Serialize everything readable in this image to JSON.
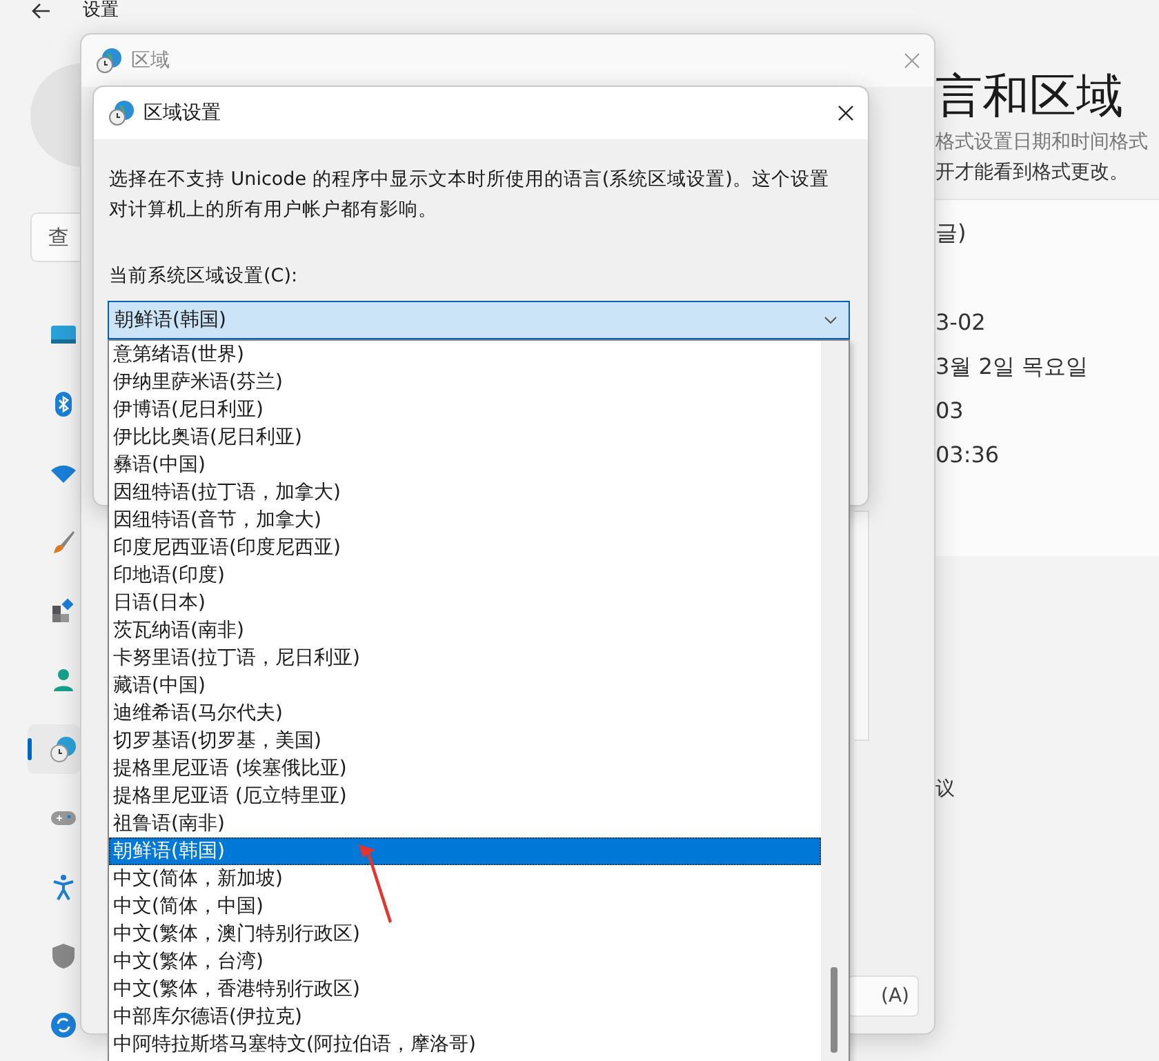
{
  "settings": {
    "title": "设置",
    "search": {
      "placeholder": "查"
    },
    "heading": "言和区域",
    "description": [
      "格式设置日期和时间格式",
      "开才能看到格式更改。"
    ],
    "values": [
      "글)",
      "3-02",
      "3월 2일 목요일",
      "03",
      "03:36"
    ],
    "lower_text": "议",
    "sidebar": {
      "items": [
        {
          "kind": "display",
          "selected": false
        },
        {
          "kind": "bluetooth",
          "selected": false
        },
        {
          "kind": "wifi",
          "selected": false
        },
        {
          "kind": "brush",
          "selected": false
        },
        {
          "kind": "apps",
          "selected": false
        },
        {
          "kind": "person",
          "selected": false
        },
        {
          "kind": "clock",
          "selected": true
        },
        {
          "kind": "gamepad",
          "selected": false
        },
        {
          "kind": "accessibility",
          "selected": false
        },
        {
          "kind": "shield",
          "selected": false
        },
        {
          "kind": "update",
          "selected": false
        }
      ]
    }
  },
  "region_dialog": {
    "title": "区域",
    "apply_button": "(A)"
  },
  "locale_dialog": {
    "title": "区域设置",
    "description": "选择在不支持 Unicode 的程序中显示文本时所使用的语言(系统区域设置)。这个设置对计算机上的所有用户帐户都有影响。",
    "label": "当前系统区域设置(C):",
    "value": "朝鲜语(韩国)",
    "options": [
      {
        "label": "意第绪语(世界)",
        "selected": false
      },
      {
        "label": "伊纳里萨米语(芬兰)",
        "selected": false
      },
      {
        "label": "伊博语(尼日利亚)",
        "selected": false
      },
      {
        "label": "伊比比奥语(尼日利亚)",
        "selected": false
      },
      {
        "label": "彝语(中国)",
        "selected": false
      },
      {
        "label": "因纽特语(拉丁语，加拿大)",
        "selected": false
      },
      {
        "label": "因纽特语(音节，加拿大)",
        "selected": false
      },
      {
        "label": "印度尼西亚语(印度尼西亚)",
        "selected": false
      },
      {
        "label": "印地语(印度)",
        "selected": false
      },
      {
        "label": "日语(日本)",
        "selected": false
      },
      {
        "label": "茨瓦纳语(南非)",
        "selected": false
      },
      {
        "label": "卡努里语(拉丁语，尼日利亚)",
        "selected": false
      },
      {
        "label": "藏语(中国)",
        "selected": false
      },
      {
        "label": "迪维希语(马尔代夫)",
        "selected": false
      },
      {
        "label": "切罗基语(切罗基，美国)",
        "selected": false
      },
      {
        "label": "提格里尼亚语 (埃塞俄比亚)",
        "selected": false
      },
      {
        "label": "提格里尼亚语 (厄立特里亚)",
        "selected": false
      },
      {
        "label": "祖鲁语(南非)",
        "selected": false
      },
      {
        "label": "朝鲜语(韩国)",
        "selected": true
      },
      {
        "label": "中文(简体，新加坡)",
        "selected": false
      },
      {
        "label": "中文(简体，中国)",
        "selected": false
      },
      {
        "label": "中文(繁体，澳门特别行政区)",
        "selected": false
      },
      {
        "label": "中文(繁体，台湾)",
        "selected": false
      },
      {
        "label": "中文(繁体，香港特别行政区)",
        "selected": false
      },
      {
        "label": "中部库尔德语(伊拉克)",
        "selected": false
      },
      {
        "label": "中阿特拉斯塔马塞特文(阿拉伯语，摩洛哥)",
        "selected": false
      }
    ]
  }
}
